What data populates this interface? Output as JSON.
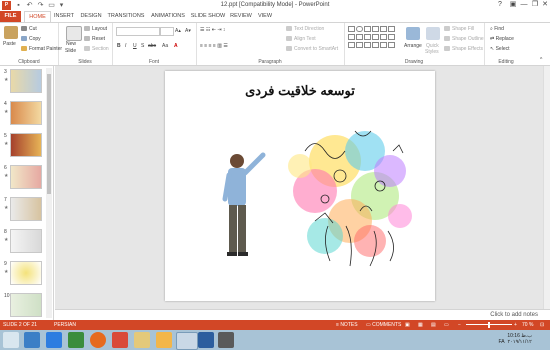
{
  "titlebar": {
    "title": "12.ppt [Compatibility Mode] - PowerPoint",
    "help": "?",
    "minimize": "—",
    "restore": "❐",
    "close": "✕"
  },
  "tabs": [
    "FILE",
    "HOME",
    "INSERT",
    "DESIGN",
    "TRANSITIONS",
    "ANIMATIONS",
    "SLIDE SHOW",
    "REVIEW",
    "VIEW"
  ],
  "active_tab": "HOME",
  "ribbon": {
    "clipboard": {
      "label": "Clipboard",
      "paste": "Paste",
      "cut": "Cut",
      "copy": "Copy",
      "format_painter": "Format Painter"
    },
    "slides": {
      "label": "Slides",
      "new_slide_1": "New",
      "new_slide_2": "Slide",
      "layout": "Layout",
      "reset": "Reset",
      "section": "Section"
    },
    "font": {
      "label": "Font",
      "bold": "B",
      "italic": "I",
      "underline": "U",
      "shadow": "S",
      "strike": "abc",
      "aa": "Aa",
      "font_color": "A"
    },
    "paragraph": {
      "label": "Paragraph",
      "text_direction": "Text Direction",
      "align_text": "Align Text",
      "convert": "Convert to SmartArt"
    },
    "drawing": {
      "label": "Drawing",
      "arrange": "Arrange",
      "quick_styles_1": "Quick",
      "quick_styles_2": "Styles",
      "shape_fill": "Shape Fill",
      "shape_outline": "Shape Outline",
      "shape_effects": "Shape Effects"
    },
    "editing": {
      "label": "Editing",
      "find": "Find",
      "replace": "Replace",
      "select": "Select"
    }
  },
  "thumbnails": [
    {
      "num": "3",
      "star": "★"
    },
    {
      "num": "4",
      "star": "★"
    },
    {
      "num": "5",
      "star": "★"
    },
    {
      "num": "6",
      "star": "★"
    },
    {
      "num": "7",
      "star": "★"
    },
    {
      "num": "8",
      "star": "★"
    },
    {
      "num": "9",
      "star": "★"
    },
    {
      "num": "10",
      "star": ""
    }
  ],
  "slide": {
    "title": "توسعه خلاقیت فردی"
  },
  "notes_placeholder": "Click to add notes",
  "statusbar": {
    "slide_info": "SLIDE 2 OF 21",
    "language": "PERSIAN",
    "notes": "NOTES",
    "comments": "COMMENTS",
    "zoom": "70 %"
  },
  "taskbar": {
    "lang": "FA",
    "time": "10:16 ب.ظ",
    "date": "۲۰۱۹/۱۱/۱۲"
  },
  "colors": {
    "accent": "#d24726",
    "taskbar": "#a8c3d6"
  }
}
